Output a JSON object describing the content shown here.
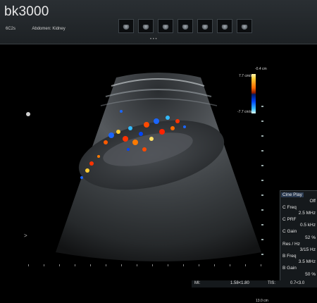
{
  "header": {
    "brand": "bk3000",
    "probe": "6C2s",
    "preset": "Abdomen: Kidney",
    "thumbnails": [
      "clip-1",
      "clip-2",
      "clip-3",
      "clip-4",
      "clip-5",
      "clip-6",
      "clip-7"
    ],
    "more_indicator": "• • •"
  },
  "scale": {
    "top_label": "-0.4 cm",
    "pos_velocity": "7.7 cm/s",
    "neg_velocity": "-7.7 cm/s"
  },
  "image": {
    "depth_label": "13.0 cm",
    "side_marker": ">"
  },
  "panel": {
    "items": [
      {
        "label": "Cine Play",
        "value": "Off"
      },
      {
        "label": "C Freq",
        "value": "2.5 MHz"
      },
      {
        "label": "C PRF",
        "value": "0.5 kHz"
      },
      {
        "label": "C Gain",
        "value": "52 %"
      },
      {
        "label": "Res / Hz",
        "value": "3/15 Hz"
      },
      {
        "label": "B Freq",
        "value": "3.5 MHz"
      },
      {
        "label": "B Gain",
        "value": "50 %"
      }
    ]
  },
  "status": {
    "mi_label": "MI:",
    "mi_value": "1.58<1.80",
    "tis_label": "TIS:",
    "tis_value": "0.7<3.0"
  },
  "colors": {
    "background": "#000000",
    "panel": "#15191c",
    "doppler_red": "#ff4a00",
    "doppler_blue": "#1a66ff"
  }
}
